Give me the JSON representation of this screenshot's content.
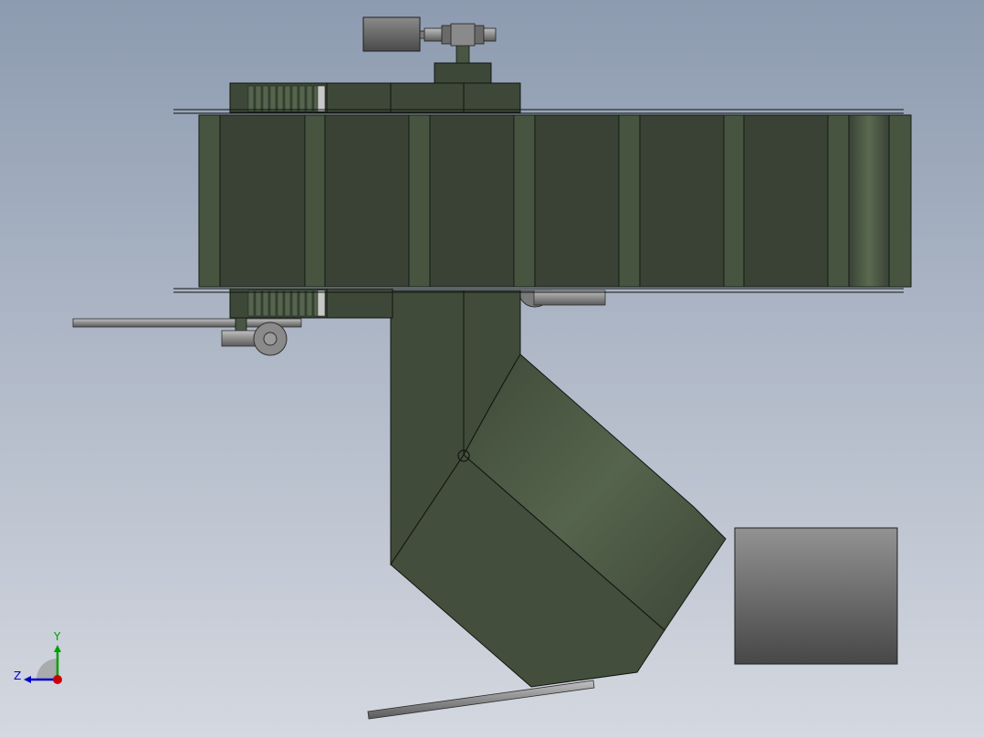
{
  "window": {
    "view": "cad-3d-model-viewport"
  },
  "colors": {
    "background_top": "#8d9bb0",
    "background_bottom": "#d4d8e0",
    "body_dark": "#3a4236",
    "body_mid": "#465440",
    "body_light": "#55644d",
    "edge": "#101510",
    "steel_light": "#b4b4b4",
    "steel_dark": "#4a4a4a",
    "axis_x": "#cc0000",
    "axis_y": "#00a000",
    "axis_z": "#0000cc"
  },
  "triad": {
    "y_label": "Y",
    "z_label": "Z"
  },
  "model": {
    "parts": [
      "conveyor-belt",
      "drive-motor",
      "gearbox",
      "discharge-chute",
      "elbow-chute",
      "collection-bin",
      "support-rod",
      "tail-pulley",
      "idler-pulley"
    ]
  }
}
